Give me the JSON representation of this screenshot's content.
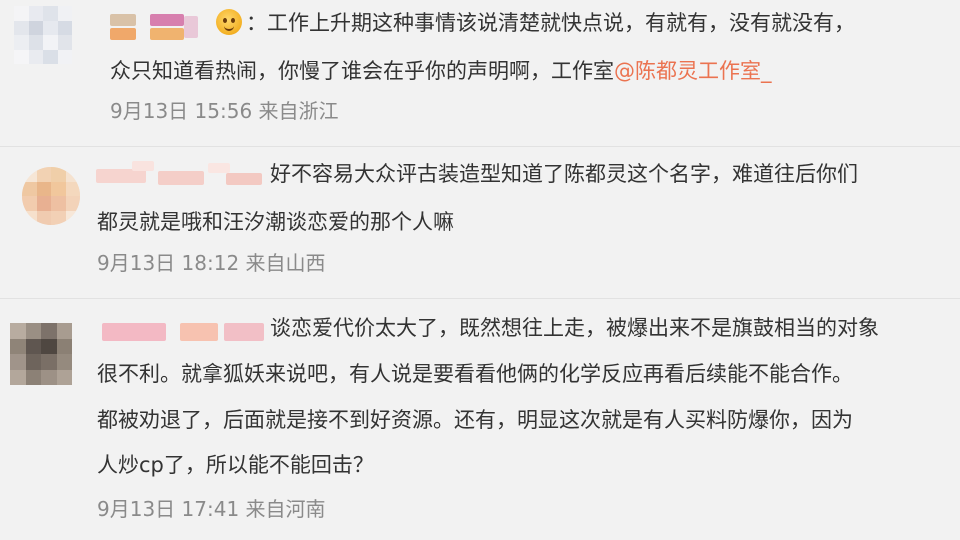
{
  "comments": [
    {
      "username": "",
      "line1": "：工作上升期这种事情该说清楚就快点说，有就有，没有就没有，",
      "line2_prefix": "众只知道看热闹，你慢了谁会在乎你的声明啊，工作室",
      "mention": "@陈都灵工作室_",
      "time": "9月13日 15:56",
      "location": "来自浙江",
      "emoji": "grinning-face-icon"
    },
    {
      "username": "",
      "line1": "好不容易大众评古装造型知道了陈都灵这个名字，难道往后你们",
      "line2": "都灵就是哦和汪汐潮谈恋爱的那个人嘛",
      "time": "9月13日 18:12",
      "location": "来自山西"
    },
    {
      "username": "",
      "line1": "谈恋爱代价太大了，既然想往上走，被爆出来不是旗鼓相当的对象",
      "line2": "很不利。就拿狐妖来说吧，有人说是要看看他俩的化学反应再看后续能不能合作。",
      "line3": "都被劝退了，后面就是接不到好资源。还有，明显这次就是有人买料防爆你，因为",
      "line4": "人炒cp了，所以能不能回击？",
      "time": "9月13日 17:41",
      "location": "来自河南"
    }
  ],
  "colors": {
    "background": "#f2f2f2",
    "text": "#333333",
    "meta": "#8a8a8a",
    "mention": "#eb7350",
    "divider": "#e2e2e2"
  }
}
